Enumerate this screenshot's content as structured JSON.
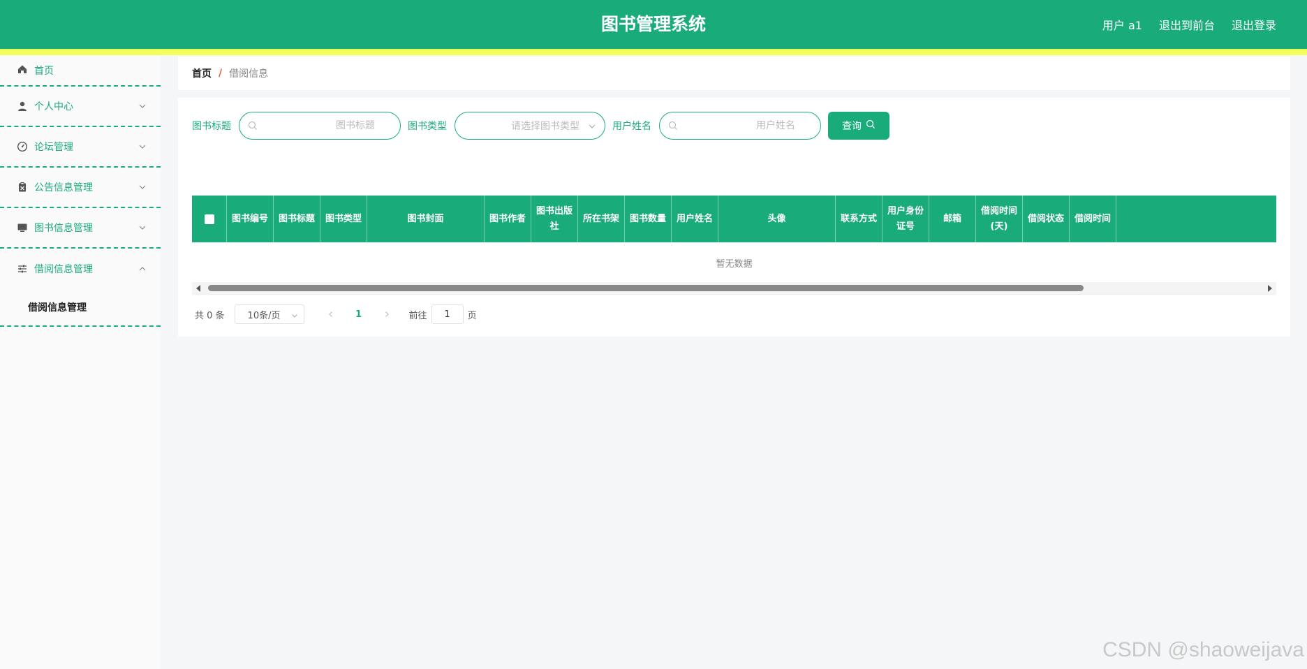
{
  "header": {
    "title": "图书管理系统",
    "user_label": "用户 a1",
    "back_to_front": "退出到前台",
    "logout": "退出登录"
  },
  "sidebar": {
    "items": [
      {
        "label": "首页",
        "icon": "home-icon"
      },
      {
        "label": "个人中心",
        "icon": "user-icon"
      },
      {
        "label": "论坛管理",
        "icon": "forum-icon"
      },
      {
        "label": "公告信息管理",
        "icon": "clipboard-icon"
      },
      {
        "label": "图书信息管理",
        "icon": "monitor-icon"
      },
      {
        "label": "借阅信息管理",
        "icon": "sliders-icon"
      }
    ],
    "submenu": {
      "label": "借阅信息管理"
    }
  },
  "breadcrumb": {
    "home": "首页",
    "separator": "/",
    "current": "借阅信息"
  },
  "search": {
    "title_label": "图书标题",
    "title_placeholder": "图书标题",
    "type_label": "图书类型",
    "type_placeholder": "请选择图书类型",
    "username_label": "用户姓名",
    "username_placeholder": "用户姓名",
    "query_button": "查询"
  },
  "table": {
    "columns": [
      {
        "label": "图书编号",
        "w": 67
      },
      {
        "label": "图书标题",
        "w": 67
      },
      {
        "label": "图书类型",
        "w": 67
      },
      {
        "label": "图书封面",
        "w": 168
      },
      {
        "label": "图书作者",
        "w": 67
      },
      {
        "label": "图书出版社",
        "w": 67
      },
      {
        "label": "所在书架",
        "w": 67
      },
      {
        "label": "图书数量",
        "w": 67
      },
      {
        "label": "用户姓名",
        "w": 67
      },
      {
        "label": "头像",
        "w": 168
      },
      {
        "label": "联系方式",
        "w": 67
      },
      {
        "label": "用户身份证号",
        "w": 67
      },
      {
        "label": "邮箱",
        "w": 67
      },
      {
        "label": "借阅时间(天)",
        "w": 67
      },
      {
        "label": "借阅状态",
        "w": 67
      },
      {
        "label": "借阅时间",
        "w": 67
      }
    ],
    "empty_text": "暂无数据"
  },
  "pagination": {
    "total": "共 0 条",
    "page_size": "10条/页",
    "current_page": "1",
    "goto_label": "前往",
    "goto_value": "1",
    "page_suffix": "页"
  },
  "watermark": "CSDN @shaoweijava",
  "colors": {
    "primary": "#1aab7b",
    "stripe": "#f2ff5a",
    "breadcrumb_separator": "#e45b3c"
  }
}
